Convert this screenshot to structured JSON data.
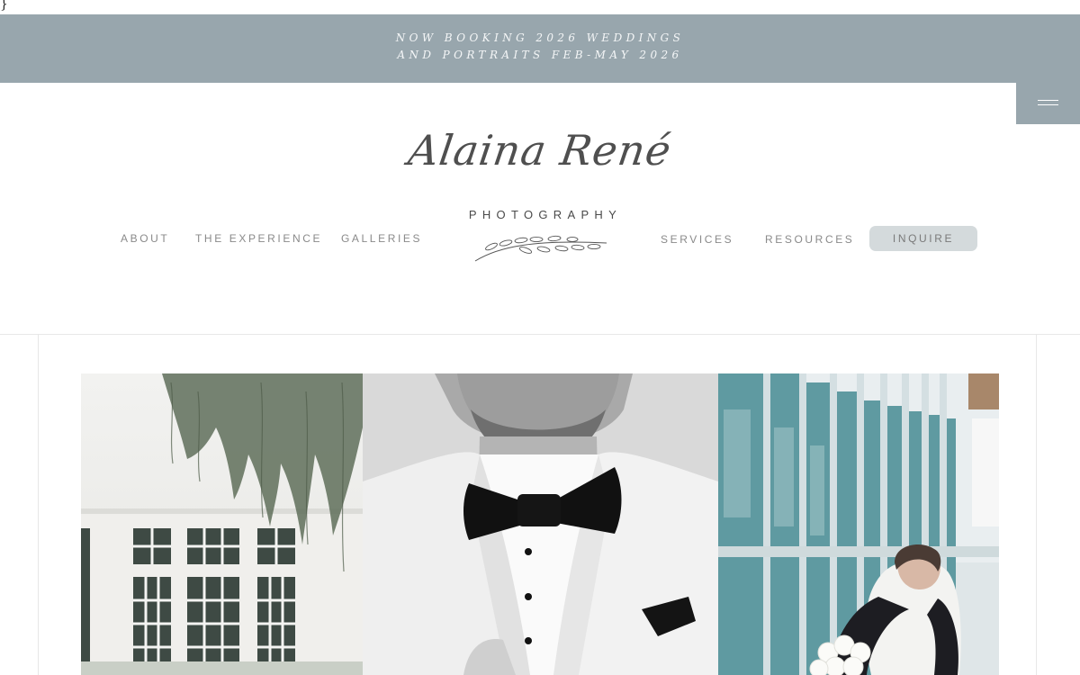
{
  "stray_char": "}",
  "announcement": {
    "line1": "NOW BOOKING 2026 WEDDINGS",
    "line2": "AND PORTRAITS FEB-MAY 2026"
  },
  "menu_button": {
    "icon": "hamburger-icon"
  },
  "logo": {
    "script": "Alaina René",
    "subtitle": "PHOTOGRAPHY",
    "ornament": "laurel-branch-icon"
  },
  "nav": {
    "left": [
      "ABOUT",
      "THE EXPERIENCE",
      "GALLERIES"
    ],
    "right": [
      "SERVICES",
      "RESOURCES"
    ],
    "cta": "INQUIRE"
  },
  "colors": {
    "banner": "#98a6ad",
    "inquire_bg": "#d4dadc",
    "nav_text": "#8a8a8a"
  },
  "gallery": [
    {
      "subject": "white-building-with-windows-and-hanging-moss"
    },
    {
      "subject": "groom-in-white-tuxedo-black-bow-tie"
    },
    {
      "subject": "bride-and-groom-embracing-by-glass-wall"
    }
  ]
}
